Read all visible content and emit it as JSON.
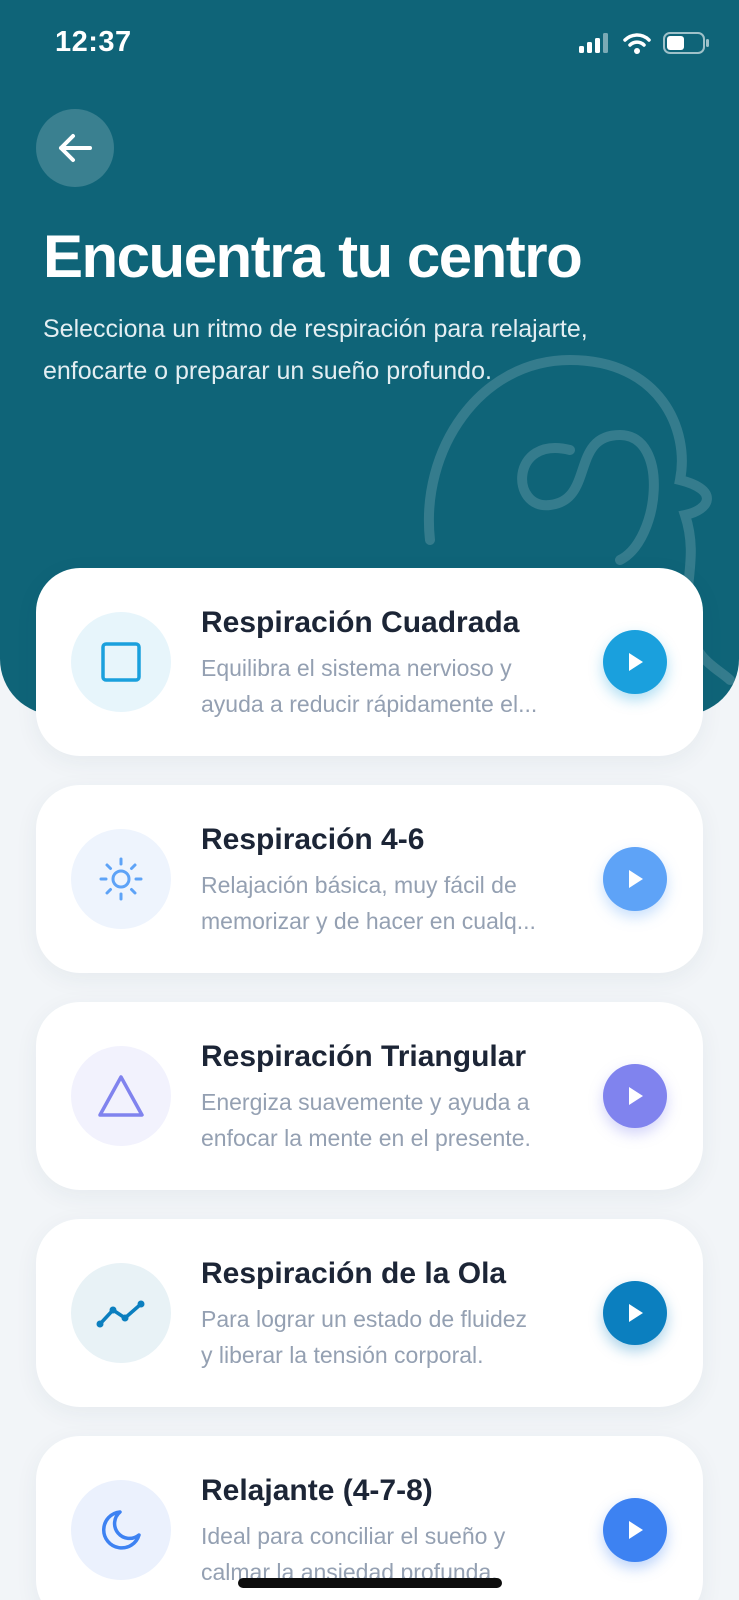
{
  "status": {
    "time": "12:37"
  },
  "header": {
    "title": "Encuentra tu centro",
    "subtitle": "Selecciona un ritmo de respiración para relajarte, enfocarte o preparar un sueño profundo."
  },
  "techniques": [
    {
      "title": "Respiración Cuadrada",
      "desc_line1": "Equilibra el sistema nervioso y",
      "desc_line2": "ayuda a reducir rápidamente el...",
      "icon": "square-icon",
      "icon_bg": "#e7f5fb",
      "accent": "#1aa0dd"
    },
    {
      "title": "Respiración 4-6",
      "desc_line1": "Relajación básica, muy fácil de",
      "desc_line2": "memorizar y de hacer en cualq...",
      "icon": "sun-icon",
      "icon_bg": "#eef4fd",
      "accent": "#5ea3f7"
    },
    {
      "title": "Respiración Triangular",
      "desc_line1": "Energiza suavemente y ayuda a",
      "desc_line2": "enfocar la mente en el presente.",
      "icon": "triangle-icon",
      "icon_bg": "#f2f2fd",
      "accent": "#8083ee"
    },
    {
      "title": "Respiración de la Ola",
      "desc_line1": "Para lograr un estado de fluidez",
      "desc_line2": "y liberar la tensión corporal.",
      "icon": "wave-chart-icon",
      "icon_bg": "#e8f2f6",
      "accent": "#0b7fbf"
    },
    {
      "title": "Relajante (4-7-8)",
      "desc_line1": "Ideal para conciliar el sueño y",
      "desc_line2": "calmar la ansiedad profunda.",
      "icon": "moon-icon",
      "icon_bg": "#ebf1fd",
      "accent": "#3d82f2"
    }
  ]
}
